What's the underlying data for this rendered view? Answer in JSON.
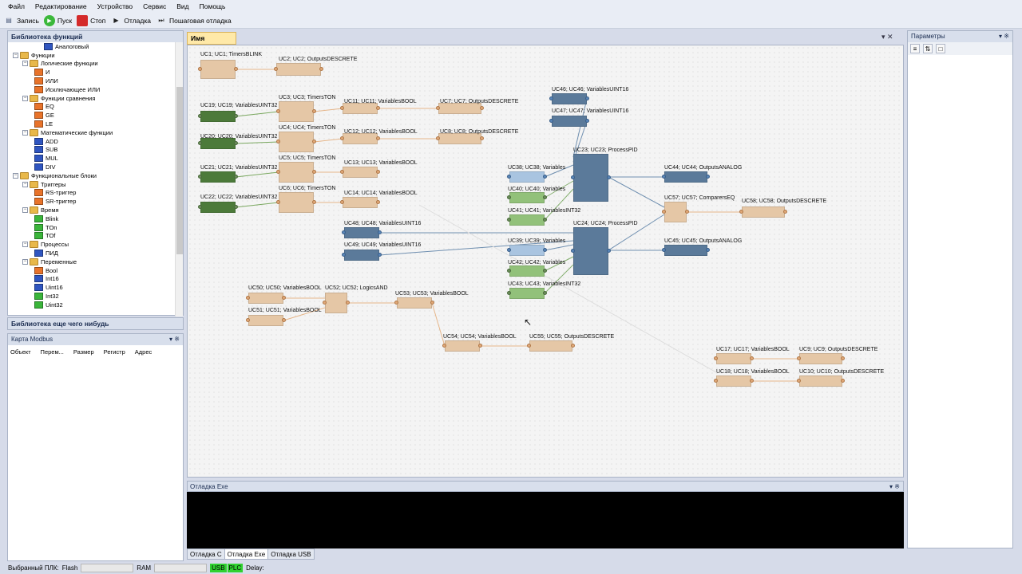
{
  "menu": [
    "Файл",
    "Редактирование",
    "Устройство",
    "Сервис",
    "Вид",
    "Помощь"
  ],
  "toolbar": {
    "record": "Запись",
    "run": "Пуск",
    "stop": "Стоп",
    "debug": "Отладка",
    "step_debug": "Пошаговая отладка"
  },
  "library": {
    "title": "Библиотека функций",
    "items": [
      {
        "label": "Аналоговый",
        "level": 3,
        "kind": "leaf",
        "color": "#2f55c0"
      },
      {
        "label": "Функции",
        "level": 0,
        "kind": "folder"
      },
      {
        "label": "Логические функции",
        "level": 1,
        "kind": "folder"
      },
      {
        "label": "И",
        "level": 2,
        "kind": "leaf",
        "color": "#e8732a"
      },
      {
        "label": "ИЛИ",
        "level": 2,
        "kind": "leaf",
        "color": "#e8732a"
      },
      {
        "label": "Исключающее ИЛИ",
        "level": 2,
        "kind": "leaf",
        "color": "#e8732a"
      },
      {
        "label": "Функции сравнения",
        "level": 1,
        "kind": "folder"
      },
      {
        "label": "EQ",
        "level": 2,
        "kind": "leaf",
        "color": "#e8732a"
      },
      {
        "label": "GE",
        "level": 2,
        "kind": "leaf",
        "color": "#e8732a"
      },
      {
        "label": "LE",
        "level": 2,
        "kind": "leaf",
        "color": "#e8732a"
      },
      {
        "label": "Математические функции",
        "level": 1,
        "kind": "folder"
      },
      {
        "label": "ADD",
        "level": 2,
        "kind": "leaf",
        "color": "#2f55c0"
      },
      {
        "label": "SUB",
        "level": 2,
        "kind": "leaf",
        "color": "#2f55c0"
      },
      {
        "label": "MUL",
        "level": 2,
        "kind": "leaf",
        "color": "#2f55c0"
      },
      {
        "label": "DIV",
        "level": 2,
        "kind": "leaf",
        "color": "#2f55c0"
      },
      {
        "label": "Функциональные блоки",
        "level": 0,
        "kind": "folder"
      },
      {
        "label": "Триггеры",
        "level": 1,
        "kind": "folder"
      },
      {
        "label": "RS-триггер",
        "level": 2,
        "kind": "leaf",
        "color": "#e8732a"
      },
      {
        "label": "SR-триггер",
        "level": 2,
        "kind": "leaf",
        "color": "#e8732a"
      },
      {
        "label": "Время",
        "level": 1,
        "kind": "folder"
      },
      {
        "label": "Blink",
        "level": 2,
        "kind": "leaf",
        "color": "#3ab53a"
      },
      {
        "label": "TOn",
        "level": 2,
        "kind": "leaf",
        "color": "#3ab53a"
      },
      {
        "label": "TOf",
        "level": 2,
        "kind": "leaf",
        "color": "#3ab53a"
      },
      {
        "label": "Процессы",
        "level": 1,
        "kind": "folder"
      },
      {
        "label": "ПИД",
        "level": 2,
        "kind": "leaf",
        "color": "#2f55c0"
      },
      {
        "label": "Переменные",
        "level": 1,
        "kind": "folder"
      },
      {
        "label": "Bool",
        "level": 2,
        "kind": "leaf",
        "color": "#e8732a"
      },
      {
        "label": "Int16",
        "level": 2,
        "kind": "leaf",
        "color": "#2f55c0"
      },
      {
        "label": "Uint16",
        "level": 2,
        "kind": "leaf",
        "color": "#2f55c0"
      },
      {
        "label": "Int32",
        "level": 2,
        "kind": "leaf",
        "color": "#3ab53a"
      },
      {
        "label": "Uint32",
        "level": 2,
        "kind": "leaf",
        "color": "#3ab53a"
      }
    ]
  },
  "library2_title": "Библиотека еще чего нибудь",
  "modbus": {
    "title": "Карта Modbus",
    "columns": [
      "Объект",
      "Перем...",
      "Размер",
      "Регистр",
      "Адрес"
    ]
  },
  "project_tab": "Имя проекта",
  "blocks": [
    {
      "label": "UC1; UC1; TimersBLINK",
      "t": "tan"
    },
    {
      "label": "UC2; UC2; OutputsDESCRETE",
      "t": "tan"
    },
    {
      "label": "UC19; UC19; VariablesUINT32",
      "t": "dgreen"
    },
    {
      "label": "UC3; UC3; TimersTON",
      "t": "tan"
    },
    {
      "label": "UC11; UC11; VariablesBOOL",
      "t": "tan"
    },
    {
      "label": "UC7; UC7; OutputsDESCRETE",
      "t": "tan"
    },
    {
      "label": "UC20; UC20; VariablesUINT32",
      "t": "dgreen"
    },
    {
      "label": "UC4; UC4; TimersTON",
      "t": "tan"
    },
    {
      "label": "UC12; UC12; VariablesBOOL",
      "t": "tan"
    },
    {
      "label": "UC8; UC8; OutputsDESCRETE",
      "t": "tan"
    },
    {
      "label": "UC21; UC21; VariablesUINT32",
      "t": "dgreen"
    },
    {
      "label": "UC5; UC5; TimersTON",
      "t": "tan"
    },
    {
      "label": "UC13; UC13; VariablesBOOL",
      "t": "tan"
    },
    {
      "label": "UC22; UC22; VariablesUINT32",
      "t": "dgreen"
    },
    {
      "label": "UC6; UC6; TimersTON",
      "t": "tan"
    },
    {
      "label": "UC14; UC14; VariablesBOOL",
      "t": "tan"
    },
    {
      "label": "UC46; UC46; VariablesUINT16",
      "t": "slate"
    },
    {
      "label": "UC47; UC47; VariablesUINT16",
      "t": "slate"
    },
    {
      "label": "UC23; UC23; ProcessPID",
      "t": "slate"
    },
    {
      "label": "UC38; UC38; Variables",
      "t": "lblue"
    },
    {
      "label": "UC40; UC40; Variables",
      "t": "lgreen"
    },
    {
      "label": "UC41; UC41; VariablesINT32",
      "t": "lgreen"
    },
    {
      "label": "UC44; UC44; OutputsANALOG",
      "t": "slate"
    },
    {
      "label": "UC57; UC57; ComparersEQ",
      "t": "tan"
    },
    {
      "label": "UC58; UC58; OutputsDESCRETE",
      "t": "tan"
    },
    {
      "label": "UC48; UC48; VariablesUINT16",
      "t": "slate"
    },
    {
      "label": "UC49; UC49; VariablesUINT16",
      "t": "slate"
    },
    {
      "label": "UC24; UC24; ProcessPID",
      "t": "slate"
    },
    {
      "label": "UC39; UC39; Variables",
      "t": "lblue"
    },
    {
      "label": "UC42; UC42; Variables",
      "t": "lgreen"
    },
    {
      "label": "UC43; UC43; VariablesINT32",
      "t": "lgreen"
    },
    {
      "label": "UC45; UC45; OutputsANALOG",
      "t": "slate"
    },
    {
      "label": "UC50; UC50; VariablesBOOL",
      "t": "tan"
    },
    {
      "label": "UC52; UC52; LogicsAND",
      "t": "tan"
    },
    {
      "label": "UC51; UC51; VariablesBOOL",
      "t": "tan"
    },
    {
      "label": "UC53; UC53; VariablesBOOL",
      "t": "tan"
    },
    {
      "label": "UC54; UC54; VariablesBOOL",
      "t": "tan"
    },
    {
      "label": "UC55; UC55; OutputsDESCRETE",
      "t": "tan"
    },
    {
      "label": "UC17; UC17; VariablesBOOL",
      "t": "tan"
    },
    {
      "label": "UC9; UC9; OutputsDESCRETE",
      "t": "tan"
    },
    {
      "label": "UC18; UC18; VariablesBOOL",
      "t": "tan"
    },
    {
      "label": "UC10; UC10; OutputsDESCRETE",
      "t": "tan"
    }
  ],
  "debug": {
    "title": "Отладка Exe",
    "tabs": [
      "Отладка C",
      "Отладка Exe",
      "Отладка USB"
    ],
    "active": 1
  },
  "params_title": "Параметры",
  "status": {
    "plc": "Выбранный ПЛК:",
    "flash": "Flash",
    "ram": "RAM",
    "usb": "USB",
    "plc_ind": "PLC",
    "delay": "Delay:"
  },
  "colors": {
    "tan": "#e5c7a6",
    "dgreen": "#4c7a3a",
    "slate": "#5b7a9a",
    "lblue": "#a9c4e0",
    "lgreen": "#92c17a"
  }
}
